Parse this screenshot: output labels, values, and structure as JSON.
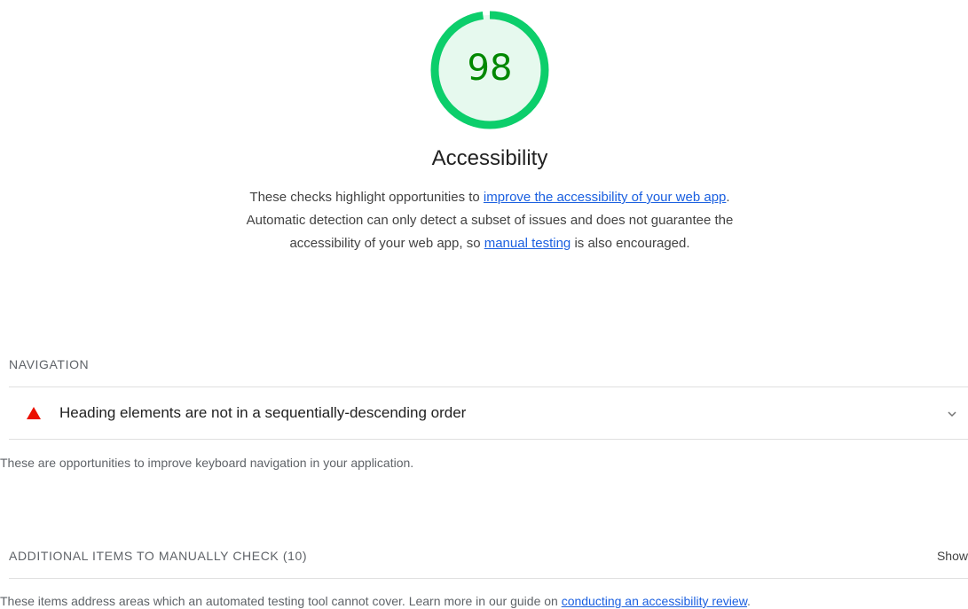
{
  "score": {
    "value": "98",
    "fraction": 0.98,
    "colors": {
      "ring": "#0cce6b",
      "fill": "#e6f9ee",
      "text": "#008800"
    }
  },
  "category": {
    "title": "Accessibility",
    "description": {
      "part1": "These checks highlight opportunities to ",
      "link1": "improve the accessibility of your web app",
      "part2": ". Automatic detection can only detect a subset of issues and does not guarantee the accessibility of your web app, so ",
      "link2": "manual testing",
      "part3": " is also encouraged."
    }
  },
  "navigation_group": {
    "title": "NAVIGATION",
    "audit": {
      "title": "Heading elements are not in a sequentially-descending order",
      "status_color": "#eb0f00",
      "status_icon": "fail-triangle-icon"
    },
    "description": "These are opportunities to improve keyboard navigation in your application."
  },
  "manual_group": {
    "title": "ADDITIONAL ITEMS TO MANUALLY CHECK (10)",
    "toggle_label": "Show",
    "description_text": "These items address areas which an automated testing tool cannot cover. Learn more in our guide on ",
    "description_link": "conducting an accessibility review",
    "description_end": "."
  }
}
